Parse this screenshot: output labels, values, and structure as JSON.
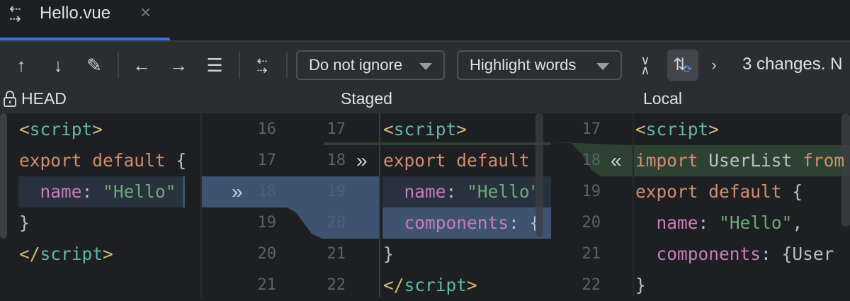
{
  "tab": {
    "title": "Hello.vue",
    "icon": "diff-icon",
    "close": "×"
  },
  "toolbar": {
    "icons": [
      "arrow-up-icon",
      "arrow-down-icon",
      "pencil-icon",
      "arrow-left-icon",
      "arrow-right-icon",
      "document-icon",
      "diff-settings-icon",
      "collapse-icon",
      "sync-scroll-icon",
      "chevron-right-icon"
    ],
    "ignore_dropdown": "Do not ignore",
    "highlight_dropdown": "Highlight words",
    "status": "3 changes. N"
  },
  "panels": {
    "head": {
      "title": "HEAD",
      "lines": [
        "<script>",
        "export default {",
        "  name: \"Hello\"",
        "}",
        "</script>",
        ""
      ]
    },
    "staged": {
      "title": "Staged",
      "left_numbers": [
        "16",
        "17",
        "18",
        "19",
        "20",
        "21"
      ],
      "numbers": [
        "17",
        "18",
        "19",
        "20",
        "21",
        "22"
      ],
      "lines": [
        "<script>",
        "export default",
        "  name: \"Hello\"",
        "  components: {",
        "}",
        "</script>"
      ]
    },
    "local": {
      "title": "Local",
      "numbers": [
        "17",
        "18",
        "19",
        "20",
        "21",
        "22"
      ],
      "lines": [
        "<script>",
        "import UserList from",
        "export default {",
        "  name: \"Hello\",",
        "  components: {User",
        "}"
      ]
    }
  },
  "colors": {
    "accent": "#3574f0",
    "modified": "#3d5370",
    "inserted": "#2e4234"
  }
}
